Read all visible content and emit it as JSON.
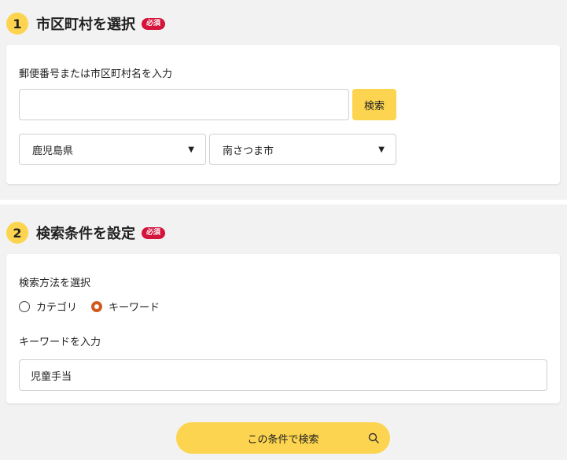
{
  "section1": {
    "step": "1",
    "title": "市区町村を選択",
    "required_badge": "必須",
    "input_label": "郵便番号または市区町村名を入力",
    "input_value": "",
    "search_button": "検索",
    "prefecture": "鹿児島県",
    "city": "南さつま市"
  },
  "section2": {
    "step": "2",
    "title": "検索条件を設定",
    "required_badge": "必須",
    "method_label": "検索方法を選択",
    "options": [
      "カテゴリ",
      "キーワード"
    ],
    "selected_option": "キーワード",
    "keyword_label": "キーワードを入力",
    "keyword_value": "児童手当"
  },
  "submit": {
    "label": "この条件で検索",
    "icon": "search-icon"
  },
  "colors": {
    "accent_yellow": "#fcd44f",
    "badge_red": "#d4143c",
    "radio_checked": "#d05a1f",
    "background": "#f2f2f2"
  }
}
